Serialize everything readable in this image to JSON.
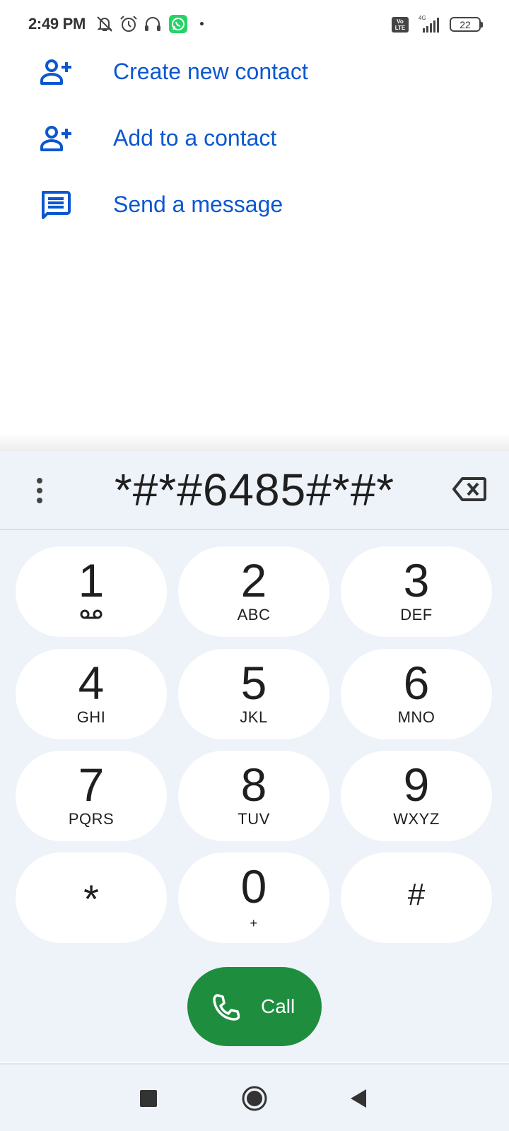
{
  "status_bar": {
    "time": "2:49 PM",
    "icons": [
      "bell-off-icon",
      "alarm-icon",
      "headset-icon",
      "whatsapp-icon",
      "notification-dot"
    ],
    "network": "4G",
    "volte": "Vo LTE",
    "battery": "22"
  },
  "actions": [
    {
      "label": "Create new contact",
      "icon": "person-add-icon"
    },
    {
      "label": "Add to a contact",
      "icon": "person-add-icon"
    },
    {
      "label": "Send a message",
      "icon": "message-icon"
    }
  ],
  "dialpad": {
    "entered_digits": "*#*#6485#*#*",
    "keys": [
      {
        "digit": "1",
        "letters": "",
        "icon": "voicemail-icon"
      },
      {
        "digit": "2",
        "letters": "ABC"
      },
      {
        "digit": "3",
        "letters": "DEF"
      },
      {
        "digit": "4",
        "letters": "GHI"
      },
      {
        "digit": "5",
        "letters": "JKL"
      },
      {
        "digit": "6",
        "letters": "MNO"
      },
      {
        "digit": "7",
        "letters": "PQRS"
      },
      {
        "digit": "8",
        "letters": "TUV"
      },
      {
        "digit": "9",
        "letters": "WXYZ"
      },
      {
        "digit": "*",
        "letters": ""
      },
      {
        "digit": "0",
        "letters": "+"
      },
      {
        "digit": "#",
        "letters": ""
      }
    ],
    "call_label": "Call"
  },
  "colors": {
    "accent": "#0b57d0",
    "call_green": "#1e8e3e",
    "dialpad_bg": "#eef2f9"
  }
}
